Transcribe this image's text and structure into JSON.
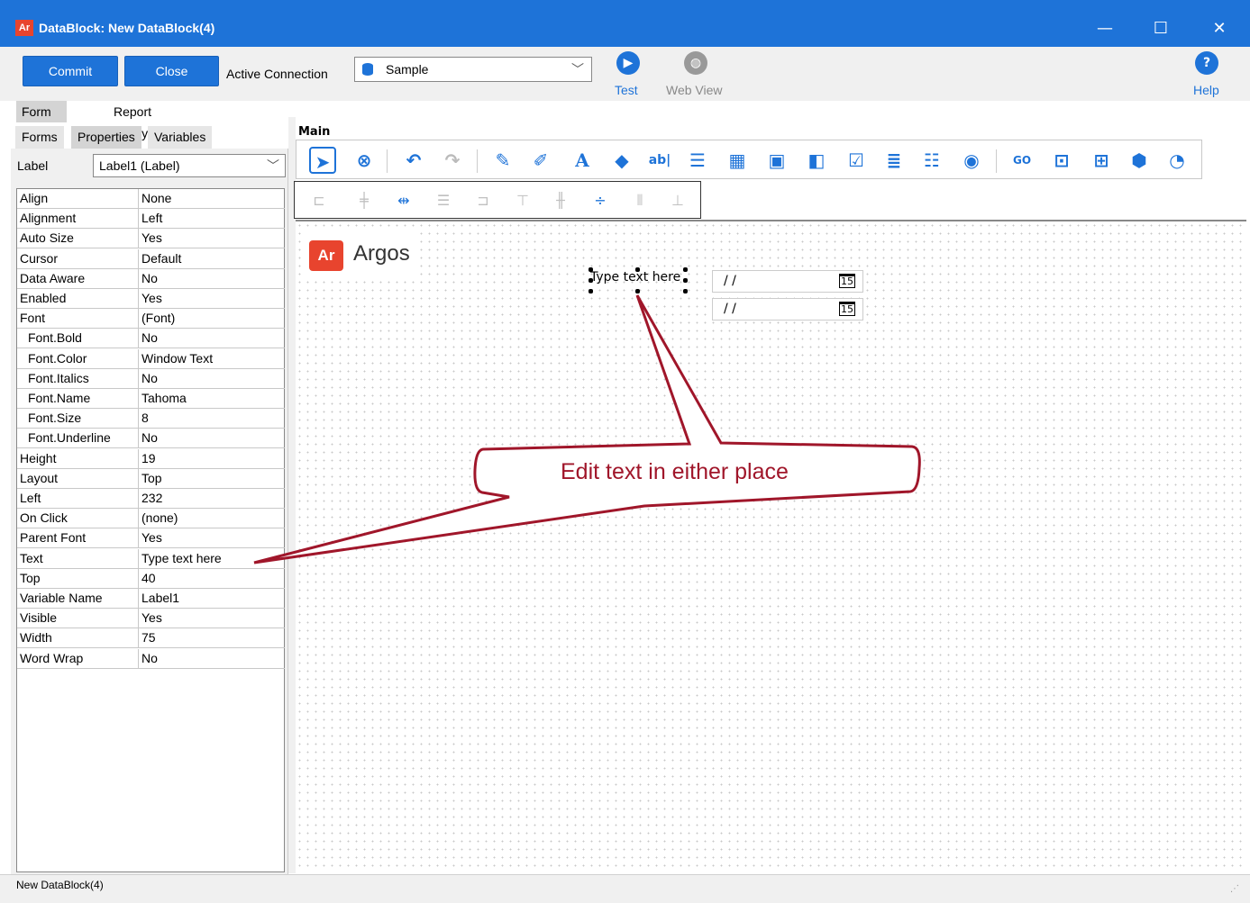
{
  "window": {
    "logo_text": "Ar",
    "title": "DataBlock: New DataBlock(4)",
    "min_glyph": "—",
    "max_glyph": "☐",
    "close_glyph": "✕"
  },
  "toolbar": {
    "commit_label": "Commit",
    "close_label": "Close",
    "active_connection_label": "Active Connection",
    "connection_value": "Sample",
    "test_label": "Test",
    "web_view_label": "Web View",
    "help_label": "Help",
    "test_icon": "play-circle-icon",
    "web_view_icon": "globe-icon",
    "help_icon": "help-circle-icon"
  },
  "tabs": [
    {
      "label": "Form Design",
      "active": true
    },
    {
      "label": "Report Query - Visual Design",
      "active": false
    }
  ],
  "subtabs": [
    {
      "label": "Forms",
      "active": false
    },
    {
      "label": "Properties",
      "active": true
    },
    {
      "label": "Variables",
      "active": false
    }
  ],
  "inspector": {
    "label": "Label",
    "selected_component": "Label1 (Label)",
    "properties": [
      {
        "key": "Align",
        "value": "None"
      },
      {
        "key": "Alignment",
        "value": "Left"
      },
      {
        "key": "Auto Size",
        "value": "Yes"
      },
      {
        "key": "Cursor",
        "value": "Default"
      },
      {
        "key": "Data Aware",
        "value": "No"
      },
      {
        "key": "Enabled",
        "value": "Yes"
      },
      {
        "key": "Font",
        "value": "(Font)"
      },
      {
        "key": "Font.Bold",
        "value": "No"
      },
      {
        "key": "Font.Color",
        "value": "Window Text"
      },
      {
        "key": "Font.Italics",
        "value": "No"
      },
      {
        "key": "Font.Name",
        "value": "Tahoma"
      },
      {
        "key": "Font.Size",
        "value": "8"
      },
      {
        "key": "Font.Underline",
        "value": "No"
      },
      {
        "key": "Height",
        "value": "19"
      },
      {
        "key": "Layout",
        "value": "Top"
      },
      {
        "key": "Left",
        "value": "232"
      },
      {
        "key": "On Click",
        "value": "(none)"
      },
      {
        "key": "Parent Font",
        "value": "Yes"
      },
      {
        "key": "Text",
        "value": "Type text here"
      },
      {
        "key": "Top",
        "value": "40"
      },
      {
        "key": "Variable Name",
        "value": "Label1"
      },
      {
        "key": "Visible",
        "value": "Yes"
      },
      {
        "key": "Width",
        "value": "75"
      },
      {
        "key": "Word Wrap",
        "value": "No"
      }
    ]
  },
  "designer": {
    "section_label": "Main",
    "logo_mark": "Ar",
    "logo_word": "Argos",
    "label_text": "Type text here",
    "date_value_1": "/ /",
    "date_value_2": "/ /",
    "cal_glyph": "15",
    "callout_text": "Edit text in either place",
    "callout_color": "#a0162a"
  },
  "status": {
    "text": "New DataBlock(4)"
  },
  "colors": {
    "accent": "#1e73d8",
    "brand": "#e8442e"
  }
}
